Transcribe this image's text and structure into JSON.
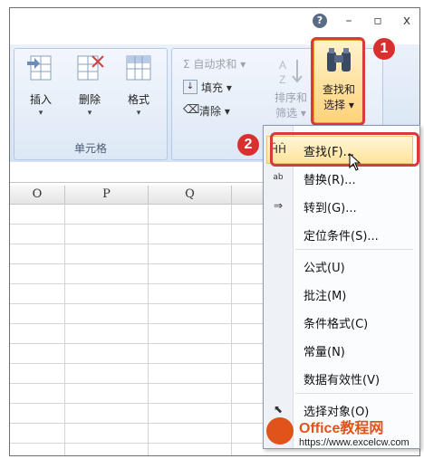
{
  "window": {
    "help": "?",
    "minimize": "–",
    "restore": "▫",
    "close": "x"
  },
  "ribbon": {
    "cells_group": {
      "label": "单元格",
      "buttons": [
        {
          "label": "插入",
          "arrow": "▾"
        },
        {
          "label": "删除",
          "arrow": "▾"
        },
        {
          "label": "格式",
          "arrow": "▾"
        }
      ]
    },
    "edit_group": {
      "autosum": "Σ 自动求和 ▾",
      "fill": "填充 ▾",
      "clear": "清除 ▾",
      "sort_filter_l1": "排序和",
      "sort_filter_l2": "筛选 ▾",
      "find_select_l1": "查找和",
      "find_select_l2": "选择 ▾"
    }
  },
  "badges": {
    "one": "1",
    "two": "2"
  },
  "grid": {
    "columns": [
      "O",
      "P",
      "Q"
    ]
  },
  "menu": {
    "items": [
      {
        "label": "查找(F)...",
        "icon": "binoculars-icon"
      },
      {
        "label": "替换(R)...",
        "icon": "replace-icon"
      },
      {
        "label": "转到(G)...",
        "icon": "arrow-right-icon"
      },
      {
        "label": "定位条件(S)..."
      },
      {
        "label": "公式(U)"
      },
      {
        "label": "批注(M)"
      },
      {
        "label": "条件格式(C)"
      },
      {
        "label": "常量(N)"
      },
      {
        "label": "数据有效性(V)"
      },
      {
        "label": "选择对象(O)",
        "icon": "pointer-icon"
      }
    ]
  },
  "watermark": {
    "title": "Office教程网",
    "url": "https://www.excelcw.com"
  },
  "colors": {
    "accent_red": "#d93a3a",
    "ribbon_blue": "#d6e3f3",
    "highlight": "#ffe39a"
  }
}
